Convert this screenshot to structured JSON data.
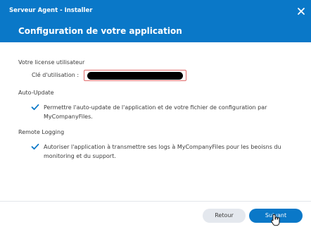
{
  "window": {
    "title": "Serveur Agent - Installer"
  },
  "banner": {
    "title": "Configuration de votre application"
  },
  "license": {
    "section_label": "Votre license utilisateur",
    "field_label": "Clé d'utilisation :",
    "value": "",
    "masked": true
  },
  "auto_update": {
    "section_label": "Auto-Update",
    "checked": true,
    "text": "Permettre l'auto-update de l'application et de votre fichier de configuration par MyCompanyFiles."
  },
  "remote_logging": {
    "section_label": "Remote Logging",
    "checked": true,
    "text": "Autoriser l'application à transmettre ses logs à MyCompanyFiles pour les beoisns du monitoring et du support."
  },
  "footer": {
    "back_label": "Retour",
    "next_label": "Suivant"
  },
  "colors": {
    "accent": "#0a78c8",
    "input_error_border": "#e06a6a",
    "secondary_button": "#e4e8ee"
  },
  "icons": {
    "close": "close-icon",
    "checkbox": "checkmark-icon",
    "cursor": "hand-pointer-icon"
  }
}
